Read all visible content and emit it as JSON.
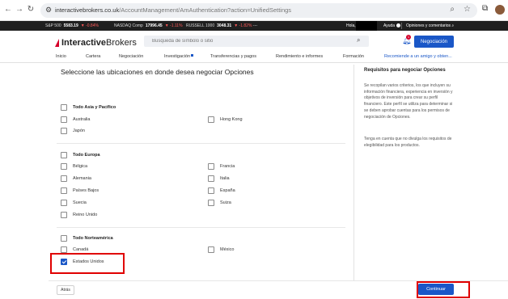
{
  "browser": {
    "url_host": "interactivebrokers.co.uk",
    "url_path": "/AccountManagement/AmAuthentication?action=UnifiedSettings",
    "back": "←",
    "forward": "→",
    "reload": "↻"
  },
  "ticker": {
    "items": [
      {
        "name": "S&P 500",
        "value": "5583.19",
        "change": "▼ -0.84%"
      },
      {
        "name": "NASDAQ Comp",
        "value": "17996.45",
        "change": "▼ -1.11%"
      },
      {
        "name": "RUSSELL 1000",
        "value": "3048.31",
        "change": "▼ -1.82%"
      }
    ],
    "more": "...",
    "hello": "Hola,",
    "help": "Ayuda",
    "opinions": "Opiniones y comentarios"
  },
  "header": {
    "logo_bold": "Interactive",
    "logo_light": "Brokers",
    "search_placeholder": "Busqueda de símbolo o sitio",
    "trade_button": "Negociación",
    "notification_count": "1",
    "menu": [
      "Inicio",
      "Cartera",
      "Negociación",
      "Investigación",
      "Transferencias y pagos",
      "Rendimiento e informes",
      "Formación",
      "Recomiende a un amigo y obten..."
    ]
  },
  "main": {
    "title": "Seleccione las ubicaciones en donde desea negociar Opciones",
    "groups": {
      "asia": {
        "all": "Todo Asia y Pacífico",
        "items": [
          "Australia",
          "Hong Kong",
          "Japón"
        ]
      },
      "europe": {
        "all": "Todo Europa",
        "items": [
          "Bélgica",
          "Francia",
          "Alemania",
          "Italia",
          "Países Bajos",
          "España",
          "Suecia",
          "Suiza",
          "Reino Unido"
        ]
      },
      "north_america": {
        "all": "Todo Norteamérica",
        "items": [
          "Canadá",
          "México",
          "Estados Unidos"
        ]
      }
    },
    "checked": [
      "Estados Unidos"
    ]
  },
  "sidebar": {
    "title": "Requisitos para negociar Opciones",
    "paragraph1": "Se recopilan varios criterios, los que incluyen su información financiera, experiencia en inversión y objetivos de inversión para crear su perfil financiero. Este perfil se utiliza para determinar si se deben aprobar cuentas para los permisos de negociación de Opciones.",
    "paragraph2": "Tenga en cuenta que no divulga los requisitos de elegibilidad para los productos."
  },
  "footer": {
    "back_button": "Atrás",
    "continue_button": "Continuar"
  },
  "colors": {
    "accent": "#1a57c7",
    "brand_red": "#d6002a",
    "highlight": "#e00000"
  }
}
